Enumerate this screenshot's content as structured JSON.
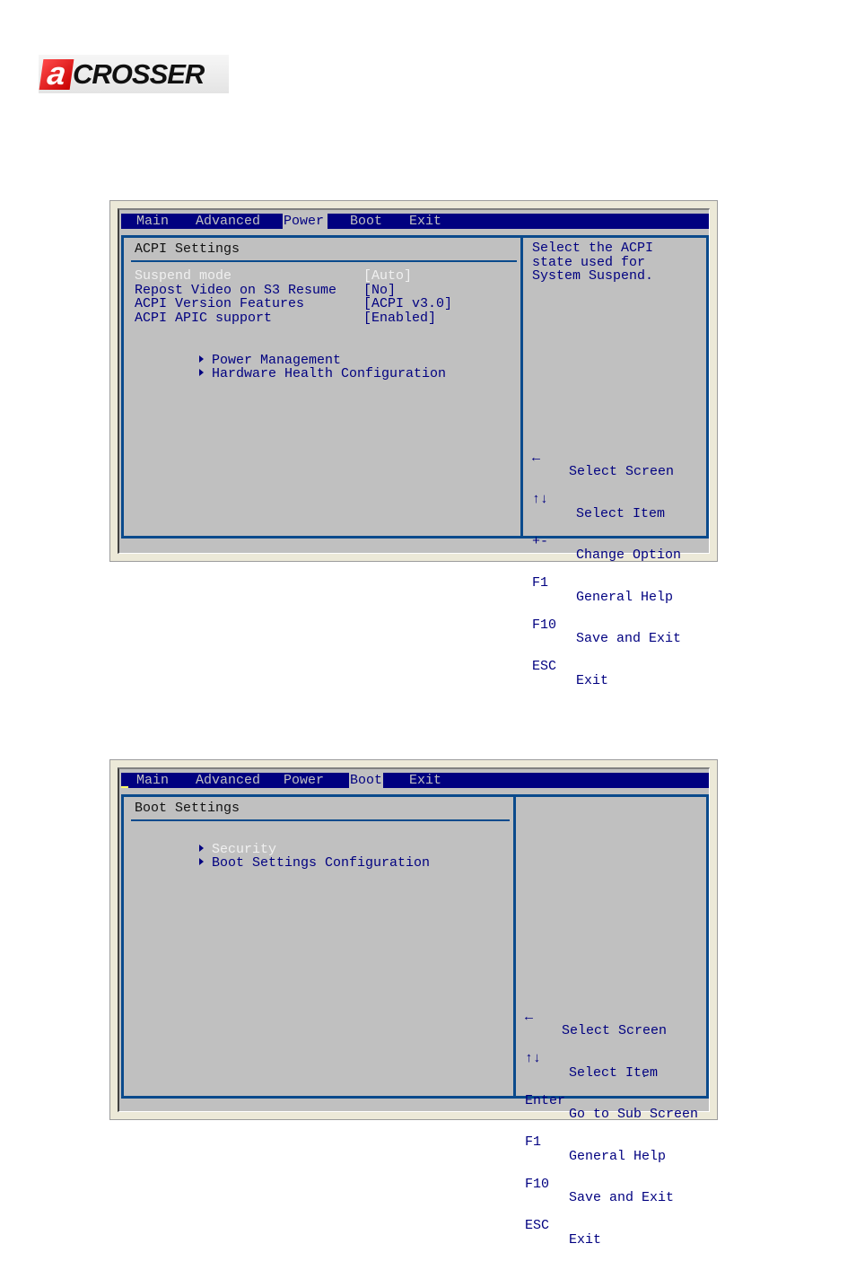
{
  "logo": {
    "mark": "a",
    "text": "CROSSER"
  },
  "screens": [
    {
      "menu": [
        {
          "label": "Main",
          "active": false
        },
        {
          "label": "Advanced",
          "active": false
        },
        {
          "label": "Power",
          "active": true
        },
        {
          "label": "Boot",
          "active": false
        },
        {
          "label": "Exit",
          "active": false
        }
      ],
      "section_title": "ACPI Settings",
      "settings": [
        {
          "label": "Suspend mode",
          "value": "[Auto]",
          "selected": true
        },
        {
          "label": "Repost Video on S3 Resume",
          "value": "[No]",
          "selected": false
        },
        {
          "label": "ACPI Version Features",
          "value": "[ACPI v3.0]",
          "selected": false
        },
        {
          "label": "ACPI APIC support",
          "value": "[Enabled]",
          "selected": false
        }
      ],
      "submenus": [
        {
          "label": "Power Management",
          "selected": false
        },
        {
          "label": "Hardware Health Configuration",
          "selected": false
        }
      ],
      "help_text": [
        "Select the ACPI",
        "state used for",
        "System Suspend."
      ],
      "keys": [
        {
          "key": "←",
          "icon": "arrow-left-icon",
          "desc": "Select Screen"
        },
        {
          "key": "↑↓",
          "icon": "arrow-up-down-icon",
          "desc": "Select Item"
        },
        {
          "key": "+-",
          "icon": "",
          "desc": "Change Option"
        },
        {
          "key": "F1",
          "icon": "",
          "desc": "General Help"
        },
        {
          "key": "F10",
          "icon": "",
          "desc": "Save and Exit"
        },
        {
          "key": "ESC",
          "icon": "",
          "desc": "Exit"
        }
      ]
    },
    {
      "menu": [
        {
          "label": "Main",
          "active": false
        },
        {
          "label": "Advanced",
          "active": false
        },
        {
          "label": "Power",
          "active": false
        },
        {
          "label": "Boot",
          "active": true
        },
        {
          "label": "Exit",
          "active": false
        }
      ],
      "section_title": "Boot Settings",
      "submenus": [
        {
          "label": "Security",
          "selected": true
        },
        {
          "label": "Boot Settings Configuration",
          "selected": false
        }
      ],
      "keys": [
        {
          "key": "←",
          "icon": "arrow-left-icon",
          "desc": "Select Screen"
        },
        {
          "key": "↑↓",
          "icon": "arrow-up-down-icon",
          "desc": "Select Item"
        },
        {
          "key": "Enter",
          "icon": "",
          "desc": "Go to Sub Screen"
        },
        {
          "key": "F1",
          "icon": "",
          "desc": "General Help"
        },
        {
          "key": "F10",
          "icon": "",
          "desc": "Save and Exit"
        },
        {
          "key": "ESC",
          "icon": "",
          "desc": "Exit"
        }
      ]
    }
  ]
}
